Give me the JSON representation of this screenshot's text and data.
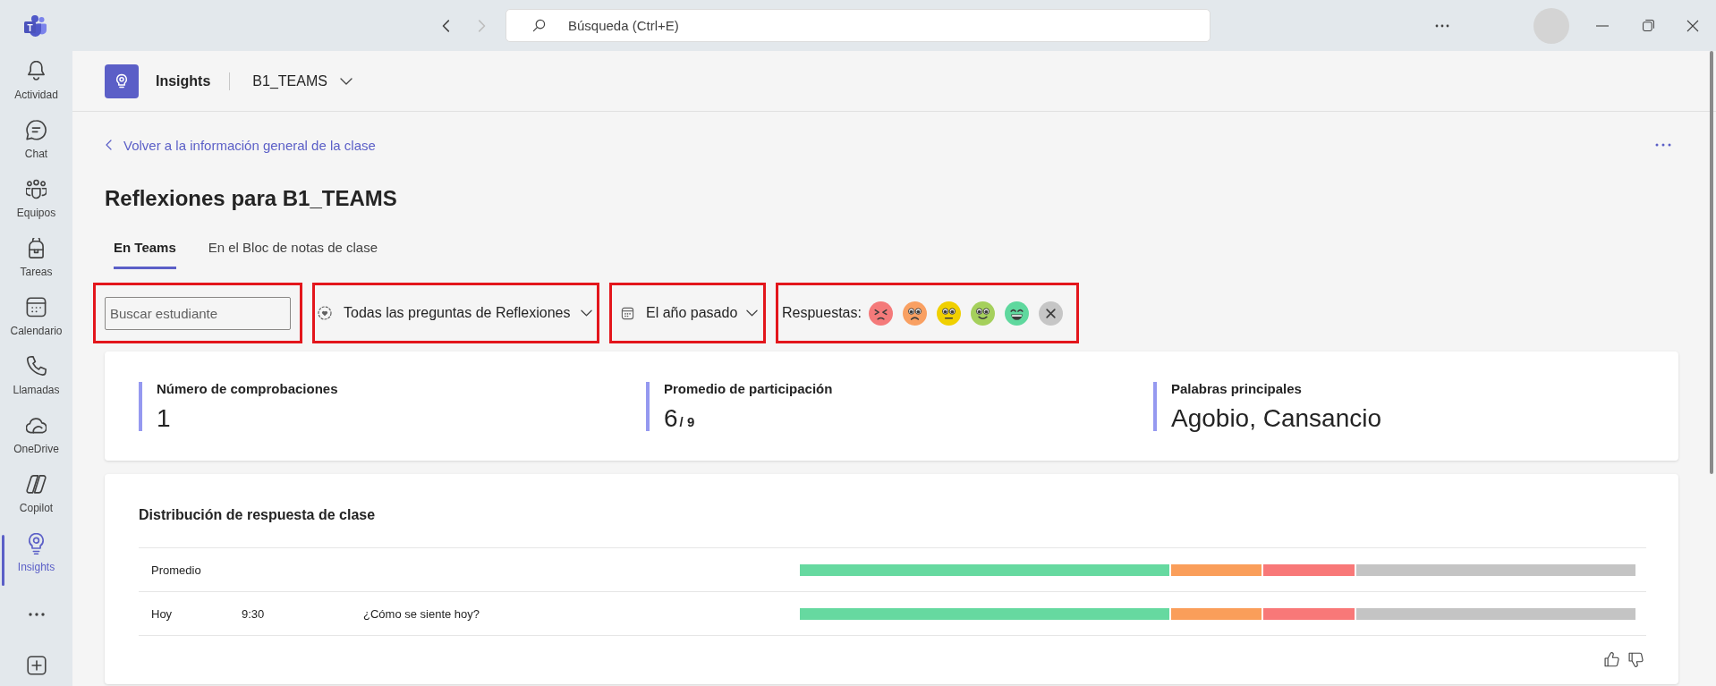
{
  "app_bar": {
    "logo": {
      "letter": "T"
    },
    "back_button": {
      "disabled": false
    },
    "forward_button": {
      "disabled": true
    },
    "search": {
      "placeholder": "Búsqueda (Ctrl+E)"
    }
  },
  "sidebar": {
    "items": [
      {
        "label": "Actividad",
        "selected": false
      },
      {
        "label": "Chat",
        "selected": false
      },
      {
        "label": "Equipos",
        "selected": false
      },
      {
        "label": "Tareas",
        "selected": false
      },
      {
        "label": "Calendario",
        "selected": false
      },
      {
        "label": "Llamadas",
        "selected": false
      },
      {
        "label": "OneDrive",
        "selected": false
      },
      {
        "label": "Copilot",
        "selected": false
      },
      {
        "label": "Insights",
        "selected": true
      }
    ]
  },
  "header": {
    "app_name": "Insights",
    "team": "B1_TEAMS"
  },
  "back_link": "Volver a la información general de la clase",
  "title": "Reflexiones para B1_TEAMS",
  "tabs": [
    {
      "label": "En Teams",
      "selected": true
    },
    {
      "label": "En el Bloc de notas de clase",
      "selected": false
    }
  ],
  "filters": {
    "student_search": {
      "placeholder": "Buscar estudiante",
      "highlighted": true
    },
    "question": {
      "value": "Todas las preguntas de Reflexiones",
      "highlighted": true
    },
    "period": {
      "value": "El año pasado",
      "highlighted": true
    },
    "responses": {
      "label": "Respuestas:",
      "highlighted": true,
      "options": [
        {
          "kind": "angry",
          "color": "#f47a7a"
        },
        {
          "kind": "sad",
          "color": "#f9a062"
        },
        {
          "kind": "neutral",
          "color": "#f0d000"
        },
        {
          "kind": "happy",
          "color": "#a5d05c"
        },
        {
          "kind": "joyful",
          "color": "#5fd89e"
        },
        {
          "kind": "clear",
          "color": "#c6c6c6"
        }
      ]
    }
  },
  "stats": [
    {
      "label": "Número de comprobaciones",
      "value": "1"
    },
    {
      "label": "Promedio de participación",
      "value": "6",
      "total": "/ 9"
    },
    {
      "label": "Palabras principales",
      "value": "Agobio, Cansancio"
    }
  ],
  "distribution": {
    "title": "Distribución de respuesta de clase",
    "rows": [
      {
        "cells": [
          "Promedio"
        ],
        "segments": [
          {
            "color": "#66d9a0",
            "level": 0.444
          },
          {
            "color": "#fa9e5a",
            "level": 0.111
          },
          {
            "color": "#f87878",
            "level": 0.111
          },
          {
            "color": "#c4c4c4",
            "level": 0.334
          }
        ]
      },
      {
        "cells": [
          "Hoy",
          "9:30",
          "¿Cómo se siente hoy?"
        ],
        "segments": [
          {
            "color": "#66d9a0",
            "level": 0.444
          },
          {
            "color": "#fa9e5a",
            "level": 0.111
          },
          {
            "color": "#f87878",
            "level": 0.111
          },
          {
            "color": "#c4c4c4",
            "level": 0.334
          }
        ]
      }
    ]
  }
}
